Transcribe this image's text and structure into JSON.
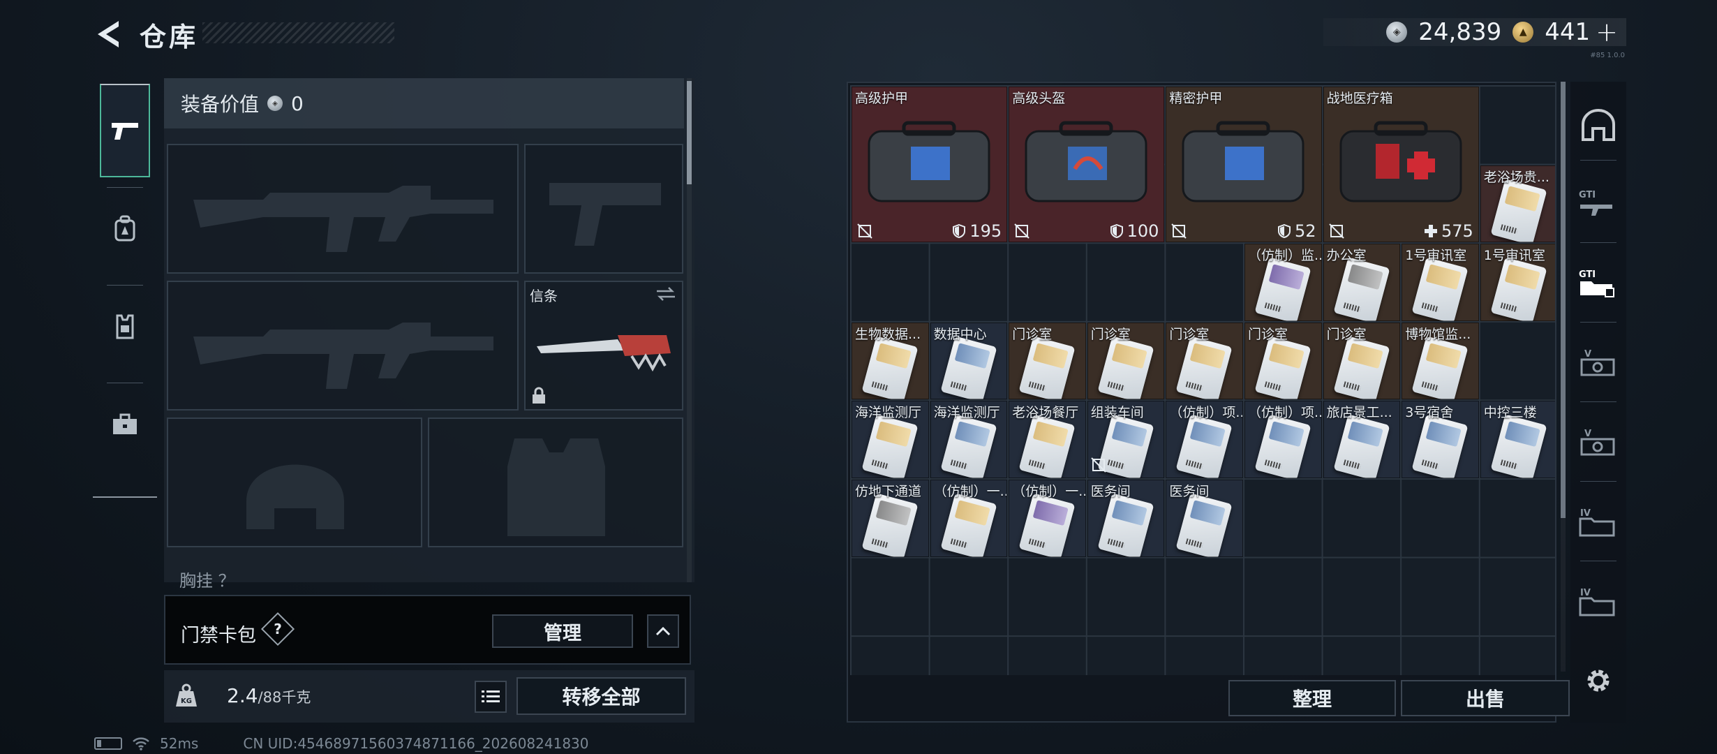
{
  "header": {
    "title": "仓库"
  },
  "currency": {
    "silver": "24,839",
    "gold": "441",
    "plus": "+"
  },
  "version": "#85 1.0.0",
  "left_nav": [
    "weapons",
    "backpack",
    "vest",
    "case"
  ],
  "equipment": {
    "value_label": "装备价值",
    "value": "0",
    "melee_label": "信条",
    "chest_label": "胸挂 ？"
  },
  "card_pack": {
    "label": "门禁卡包",
    "help": "?",
    "manage": "管理"
  },
  "footer_left": {
    "weight_current": "2.4",
    "weight_max": "/88千克",
    "transfer_all": "转移全部"
  },
  "warehouse": {
    "big_items": [
      {
        "name": "高级护甲",
        "value": "195",
        "value_icon": "shield-icon",
        "tone": "red"
      },
      {
        "name": "高级头盔",
        "value": "100",
        "value_icon": "shield-icon",
        "tone": "red"
      },
      {
        "name": "精密护甲",
        "value": "52",
        "value_icon": "shield-icon",
        "tone": "brown"
      },
      {
        "name": "战地医疗箱",
        "value": "575",
        "value_icon": "medical-plus-icon",
        "tone": "brown"
      }
    ],
    "rows": [
      [
        {
          "name": "老浴场贵...",
          "tone": "red2",
          "card": "c-yellow"
        }
      ],
      [
        {
          "name": "（仿制）监...",
          "tone": "brown",
          "card": "c-purple"
        },
        {
          "name": "办公室",
          "tone": "brown",
          "card": "c-gray"
        },
        {
          "name": "1号审讯室",
          "tone": "brown",
          "card": "c-yellow"
        },
        {
          "name": "1号审讯室",
          "tone": "brown",
          "card": "c-yellow"
        }
      ],
      [
        {
          "name": "生物数据...",
          "tone": "brown",
          "card": "c-yellow"
        },
        {
          "name": "数据中心",
          "tone": "blue",
          "card": "c-blue"
        },
        {
          "name": "门诊室",
          "tone": "brown",
          "card": "c-yellow"
        },
        {
          "name": "门诊室",
          "tone": "brown",
          "card": "c-yellow"
        },
        {
          "name": "门诊室",
          "tone": "brown",
          "card": "c-yellow"
        },
        {
          "name": "门诊室",
          "tone": "brown",
          "card": "c-yellow"
        },
        {
          "name": "门诊室",
          "tone": "brown",
          "card": "c-yellow"
        },
        {
          "name": "博物馆监...",
          "tone": "brown",
          "card": "c-yellow"
        }
      ],
      [
        {
          "name": "海洋监测厅",
          "tone": "blue",
          "card": "c-yellow"
        },
        {
          "name": "海洋监测厅",
          "tone": "blue",
          "card": "c-blue"
        },
        {
          "name": "老浴场餐厅",
          "tone": "blue",
          "card": "c-yellow"
        },
        {
          "name": "组装车间",
          "tone": "blue",
          "card": "c-blue"
        },
        {
          "name": "（仿制）项...",
          "tone": "blue",
          "card": "c-blue"
        },
        {
          "name": "（仿制）项...",
          "tone": "blue",
          "card": "c-blue"
        },
        {
          "name": "旅店景工...",
          "tone": "blue",
          "card": "c-blue"
        },
        {
          "name": "3号宿舍",
          "tone": "blue",
          "card": "c-blue"
        },
        {
          "name": "中控三楼",
          "tone": "blue",
          "card": "c-blue"
        }
      ],
      [
        {
          "name": "仿地下通道",
          "tone": "blue",
          "card": "c-gray"
        },
        {
          "name": "（仿制）一...",
          "tone": "blue",
          "card": "c-yellow"
        },
        {
          "name": "（仿制）一...",
          "tone": "blue",
          "card": "c-purple"
        },
        {
          "name": "医务间",
          "tone": "blue",
          "card": "c-blue"
        },
        {
          "name": "医务间",
          "tone": "blue",
          "card": "c-blue"
        }
      ]
    ],
    "sort": "整理",
    "sell": "出售"
  },
  "right_nav": [
    "dome-icon",
    "gti-rifle-icon",
    "gti-case-icon",
    "v-case-icon",
    "v-case-icon",
    "iv-folder-icon",
    "iv-folder-icon"
  ],
  "status": {
    "ping": "52ms",
    "uid": "CN UID:454689715603748711​66_202608241830"
  }
}
